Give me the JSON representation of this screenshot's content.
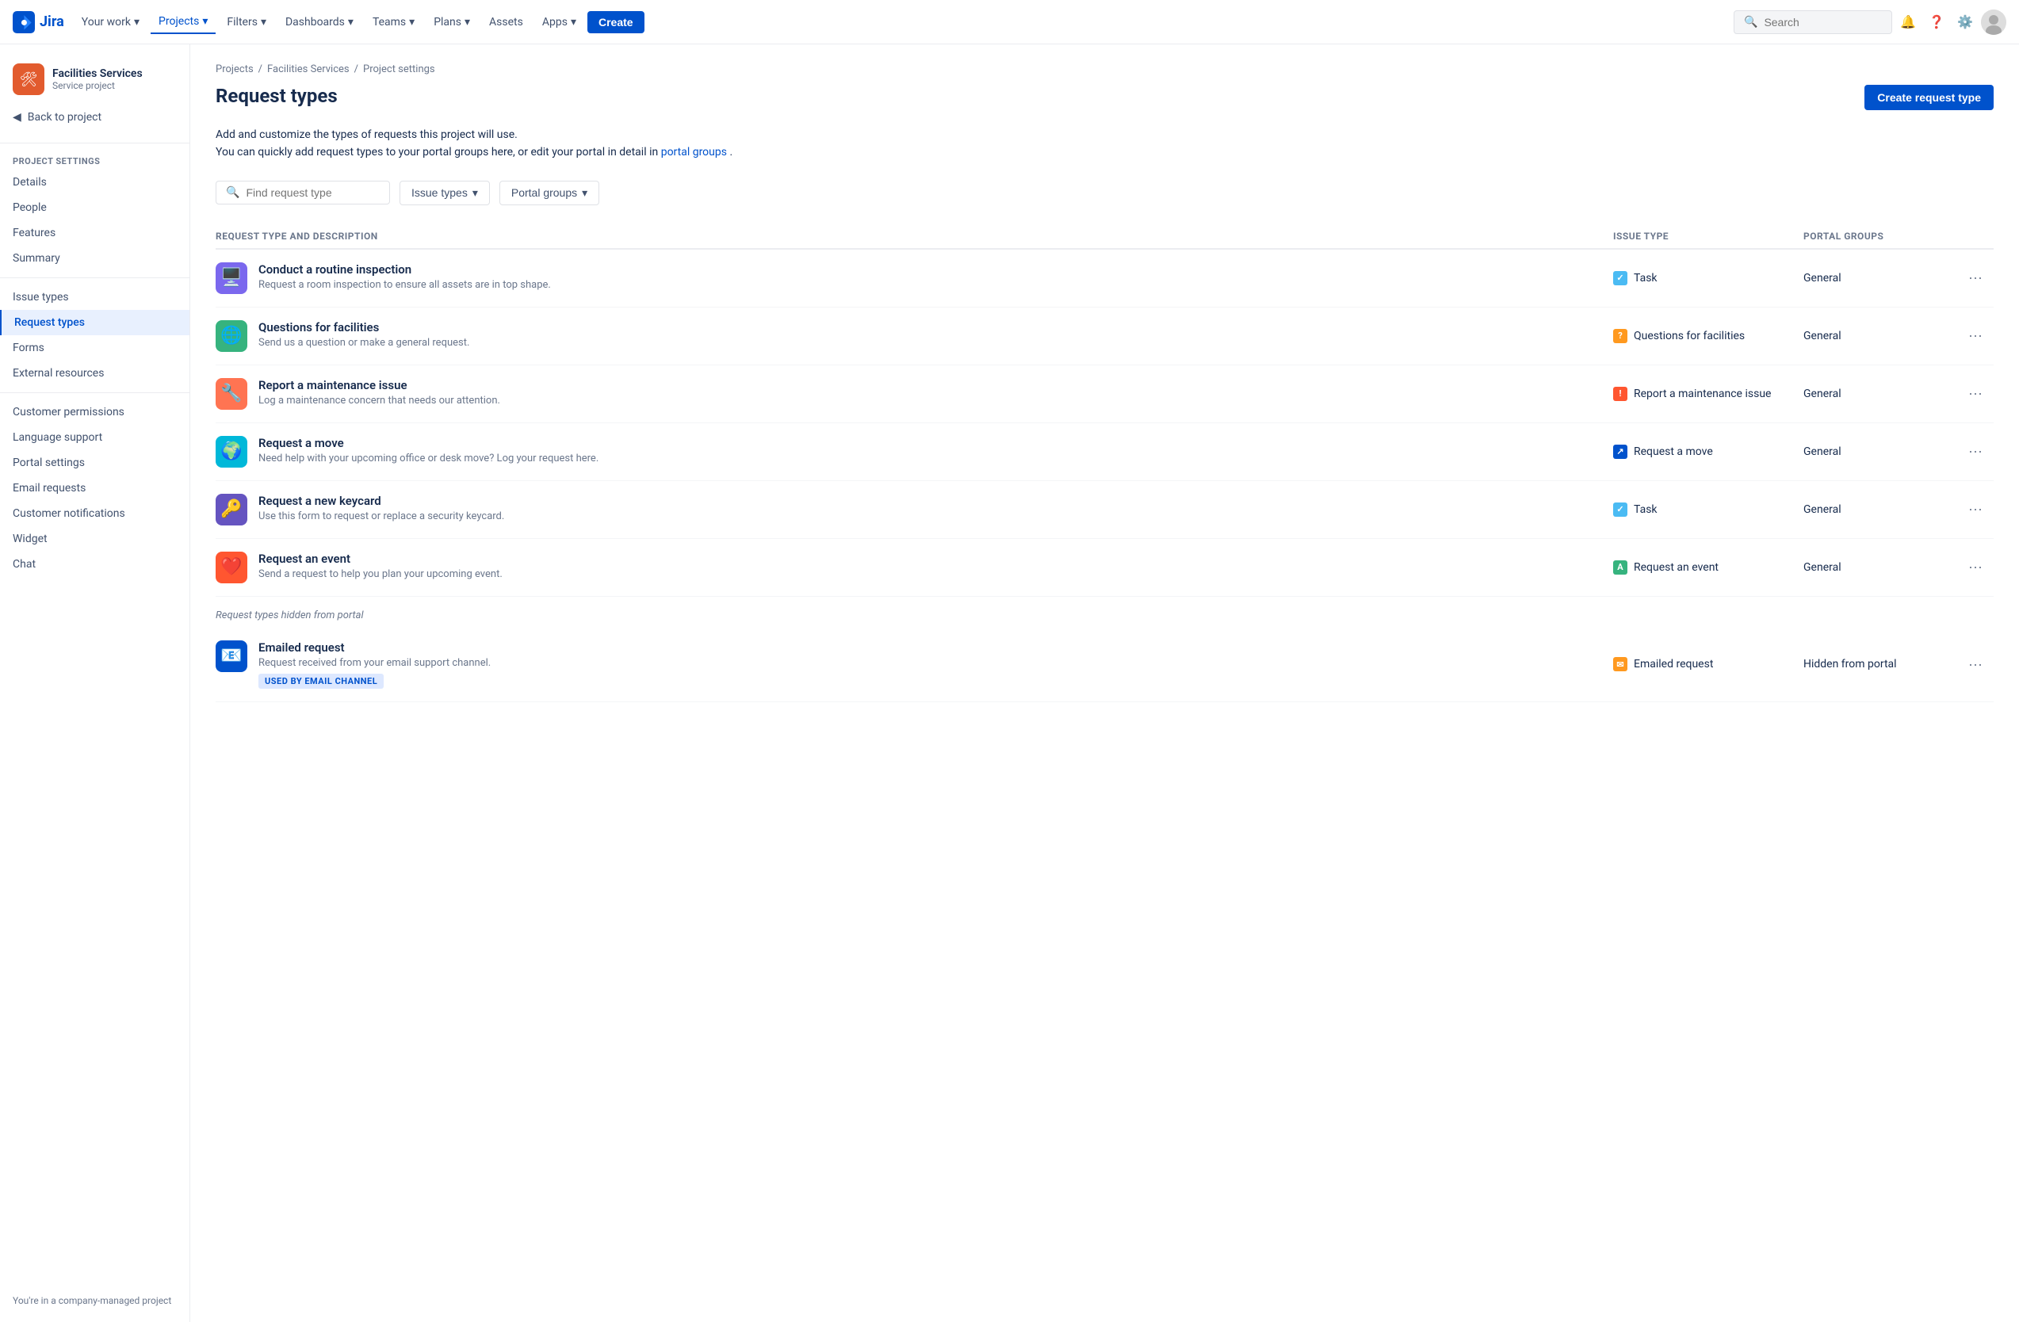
{
  "nav": {
    "logo_text": "Jira",
    "items": [
      {
        "label": "Your work",
        "dropdown": true,
        "active": false
      },
      {
        "label": "Projects",
        "dropdown": true,
        "active": true
      },
      {
        "label": "Filters",
        "dropdown": true,
        "active": false
      },
      {
        "label": "Dashboards",
        "dropdown": true,
        "active": false
      },
      {
        "label": "Teams",
        "dropdown": true,
        "active": false
      },
      {
        "label": "Plans",
        "dropdown": true,
        "active": false
      },
      {
        "label": "Assets",
        "dropdown": false,
        "active": false
      },
      {
        "label": "Apps",
        "dropdown": true,
        "active": false
      }
    ],
    "create_label": "Create",
    "search_placeholder": "Search"
  },
  "sidebar": {
    "project_name": "Facilities Services",
    "project_type": "Service project",
    "back_label": "Back to project",
    "section_label": "Project settings",
    "items": [
      {
        "label": "Details",
        "active": false
      },
      {
        "label": "People",
        "active": false
      },
      {
        "label": "Features",
        "active": false
      },
      {
        "label": "Summary",
        "active": false
      },
      {
        "label": "Issue types",
        "active": false
      },
      {
        "label": "Request types",
        "active": true
      },
      {
        "label": "Forms",
        "active": false
      },
      {
        "label": "External resources",
        "active": false
      },
      {
        "label": "Customer permissions",
        "active": false
      },
      {
        "label": "Language support",
        "active": false
      },
      {
        "label": "Portal settings",
        "active": false
      },
      {
        "label": "Email requests",
        "active": false
      },
      {
        "label": "Customer notifications",
        "active": false
      },
      {
        "label": "Widget",
        "active": false
      },
      {
        "label": "Chat",
        "active": false
      }
    ],
    "company_note": "You're in a company-managed project"
  },
  "breadcrumb": {
    "items": [
      "Projects",
      "Facilities Services",
      "Project settings"
    ]
  },
  "page": {
    "title": "Request types",
    "create_button": "Create request type",
    "desc_line1": "Add and customize the types of requests this project will use.",
    "desc_line2": "You can quickly add request types to your portal groups here, or edit your portal in detail in",
    "portal_link": "portal groups",
    "desc_end": ".",
    "search_placeholder": "Find request type",
    "filter_issue_types": "Issue types",
    "filter_portal_groups": "Portal groups"
  },
  "table": {
    "headers": {
      "request_type": "Request type and description",
      "issue_type": "Issue type",
      "portal_groups": "Portal groups"
    },
    "rows": [
      {
        "name": "Conduct a routine inspection",
        "description": "Request a room inspection to ensure all assets are in top shape.",
        "icon": "🖥️",
        "icon_bg": "#6554c0",
        "issue_type_label": "Task",
        "issue_type_color": "#4bbbf3",
        "issue_type_icon": "✓",
        "portal_group": "General"
      },
      {
        "name": "Questions for facilities",
        "description": "Send us a question or make a general request.",
        "icon": "🌐",
        "icon_bg": "#0052cc",
        "issue_type_label": "Questions for facilities",
        "issue_type_color": "#ff991f",
        "issue_type_icon": "?",
        "portal_group": "General"
      },
      {
        "name": "Report a maintenance issue",
        "description": "Log a maintenance concern that needs our attention.",
        "icon": "🔧",
        "icon_bg": "#ff5630",
        "issue_type_label": "Report a maintenance issue",
        "issue_type_color": "#ff5630",
        "issue_type_icon": "!",
        "portal_group": "General"
      },
      {
        "name": "Request a move",
        "description": "Need help with your upcoming office or desk move? Log your request here.",
        "icon": "🌍",
        "icon_bg": "#00b8d9",
        "issue_type_label": "Request a move",
        "issue_type_color": "#0052cc",
        "issue_type_icon": "↗",
        "portal_group": "General"
      },
      {
        "name": "Request a new keycard",
        "description": "Use this form to request or replace a security keycard.",
        "icon": "🔑",
        "icon_bg": "#0052cc",
        "issue_type_label": "Task",
        "issue_type_color": "#4bbbf3",
        "issue_type_icon": "✓",
        "portal_group": "General"
      },
      {
        "name": "Request an event",
        "description": "Send a request to help you plan your upcoming event.",
        "icon": "❤️",
        "icon_bg": "#ff5630",
        "issue_type_label": "Request an event",
        "issue_type_color": "#36b37e",
        "issue_type_icon": "A",
        "portal_group": "General"
      }
    ],
    "hidden_section_label": "Request types hidden from portal",
    "hidden_rows": [
      {
        "name": "Emailed request",
        "description": "Request received from your email support channel.",
        "icon": "✉️",
        "icon_bg": "#00b8d9",
        "issue_type_label": "Emailed request",
        "issue_type_color": "#ff991f",
        "issue_type_icon": "✉",
        "portal_group": "Hidden from portal",
        "badge": "USED BY EMAIL CHANNEL"
      }
    ]
  }
}
